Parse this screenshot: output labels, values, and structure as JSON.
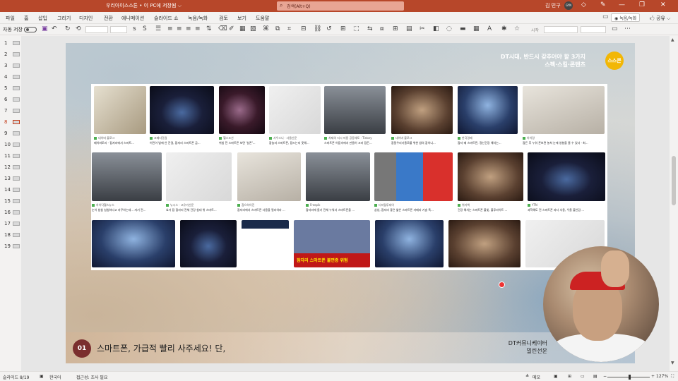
{
  "titlebar": {
    "doc_title": "우리아이스스톤 • 이 PC에 저장됨 ⌵",
    "search_placeholder": "검색(Alt+Q)",
    "user_name": "김 민구",
    "avatar_text": "GYN"
  },
  "menu": {
    "tabs": [
      "파일",
      "홈",
      "삽입",
      "그리기",
      "디자인",
      "전환",
      "애니메이션",
      "슬라이드 쇼",
      "녹음/녹화",
      "검토",
      "보기",
      "도움말"
    ],
    "record_label": "◉ 녹음/녹화",
    "share_label": "🖒 공유 ⌵"
  },
  "toolbar": {
    "autosave_label": "자동 저장",
    "autosave_state": "off",
    "start_label": "시작"
  },
  "thumbnails": {
    "slides": [
      "1",
      "2",
      "3",
      "4",
      "5",
      "6",
      "7",
      "8",
      "9",
      "10",
      "11",
      "12",
      "13",
      "14",
      "15",
      "16",
      "17",
      "18",
      "19"
    ],
    "active": "8"
  },
  "slide": {
    "brand_line1": "DT시대, 반드시 갖추어야 할 3가지",
    "brand_line2": "스펙·스킬·콘텐츠",
    "logo_text": "스스콘",
    "number": "01",
    "caption": "스마트폰, 가급적 빨리 사주세요! 단,",
    "credit_line1": "DT커뮤니케이터",
    "credit_line2": "밀린선운"
  },
  "image_results": {
    "row1": [
      {
        "source": "네이버 블로그",
        "desc": "베이비토리 - 잠자리에서 스마트...",
        "style": "cartoon"
      },
      {
        "source": "코메디닷컴",
        "desc": "어린이 밤에 안 잔걸, 잠자리 스마트폰 금...",
        "style": "dark1"
      },
      {
        "source": "헬스조선",
        "desc": "취침 전 스마트폰 보면 '실존'...",
        "style": "dark2"
      },
      {
        "source": "사우스니 · 사물신문",
        "desc": "잠늘지 스마트폰, 잠드는지 못해...",
        "style": "light1"
      },
      {
        "source": "처제의 지시 미용 공동체토 · Tistory",
        "desc": "스마트폰 어둠속에서 만들어 끄러 잠든...",
        "style": "grey"
      },
      {
        "source": "네이버 블로그",
        "desc": "잠잘우리기울로를 위한 밤의 잡히니...",
        "style": "warm"
      },
      {
        "source": "한국경제",
        "desc": "잠자 때 스마트폰, 정신건강 해치는...",
        "style": "blue"
      },
      {
        "source": "아이랑",
        "desc": "잠든 후 누워 폰보면 놓쳐 눈에 영향을 줄 수 있다 · 최...",
        "style": "bed"
      }
    ],
    "row2": [
      {
        "source": "하이닥헬스뉴스",
        "desc": "눈이 침침 침침하다고 자꾸하는데... 자기 전...",
        "style": "grey"
      },
      {
        "source": "뉴시스 · 고유가신문",
        "desc": "요거 잠 잠자리 전체 건강 침대 위 스마트...",
        "style": "light1"
      },
      {
        "source": "참으하이진",
        "desc": "잠자리에서 스마트폰 사용을 멀리하라 ...",
        "style": "bed"
      },
      {
        "source": "Freepik",
        "desc": "잠자리에 들기 전체 누워서 스마트폰을 ...",
        "style": "grey"
      },
      {
        "source": "디지털투데이",
        "desc": "삼성, 잠자리 좋은 얇은 스마트폰 카메라 기술 특...",
        "style": "phones"
      },
      {
        "source": "위키백",
        "desc": "건강 해치는 스마트폰 블빛, 블루라이트 ...",
        "style": "warm"
      },
      {
        "source": "YTN",
        "desc": "과학해도 전 스마트폰 과다 사용, 우울 불안감 ...",
        "style": "dark1"
      }
    ],
    "row3": [
      {
        "style": "blue"
      },
      {
        "style": "dark1"
      },
      {
        "style": "chart"
      },
      {
        "style": "news",
        "overlay": "잠자리 스마트폰 불면증 위험"
      },
      {
        "style": "blue"
      },
      {
        "style": "warm"
      },
      {
        "style": "light1"
      }
    ]
  },
  "statusbar": {
    "slide_info": "슬라이드 8/19",
    "language": "한국어",
    "accessibility": "접근성: 조사 필요",
    "notes_label": "메모",
    "zoom": "127%"
  }
}
